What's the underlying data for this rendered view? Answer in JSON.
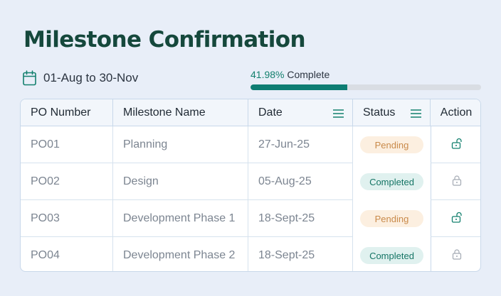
{
  "page": {
    "title": "Milestone Confirmation",
    "date_range": "01-Aug to 30-Nov",
    "progress": {
      "percent_label": "41.98%",
      "suffix": " Complete",
      "value": 41.98
    }
  },
  "table": {
    "columns": [
      "PO Number",
      "Milestone Name",
      "Date",
      "Status",
      "Action"
    ],
    "rows": [
      {
        "po": "PO01",
        "milestone": "Planning",
        "date": "27-Jun-25",
        "status": "Pending",
        "action": "unlock-icon"
      },
      {
        "po": "PO02",
        "milestone": "Design",
        "date": "05-Aug-25",
        "status": "Completed",
        "action": "lock-icon"
      },
      {
        "po": "PO03",
        "milestone": "Development Phase 1",
        "date": "18-Sept-25",
        "status": "Pending",
        "action": "unlock-icon"
      },
      {
        "po": "PO04",
        "milestone": "Development Phase 2",
        "date": "18-Sept-25",
        "status": "Completed",
        "action": "lock-icon"
      }
    ]
  },
  "colors": {
    "title": "#15483c",
    "accent": "#0d7d73",
    "pending_bg": "#fcefe0",
    "pending_text": "#c98a4a",
    "completed_bg": "#e0f1ef",
    "completed_text": "#157565"
  }
}
